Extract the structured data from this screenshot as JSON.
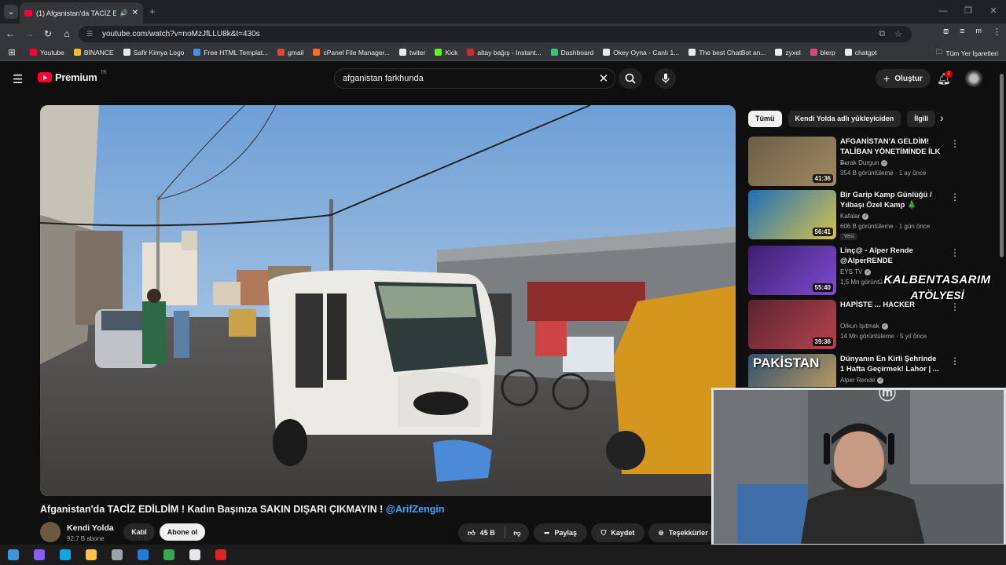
{
  "browser": {
    "tab_title": "(1) Afganistan'da TACİZ EDİ...",
    "url": "youtube.com/watch?v=noMzJfLLU8k&t=430s",
    "bookmarks": [
      {
        "label": "Youtube",
        "color": "#ff0033"
      },
      {
        "label": "BİNANCE",
        "color": "#f3ba2f"
      },
      {
        "label": "Safir Kimya Logo",
        "color": "#e8eaed"
      },
      {
        "label": "Free HTML Templat...",
        "color": "#4a90d9"
      },
      {
        "label": "gmail",
        "color": "#ea4335"
      },
      {
        "label": "cPanel File Manager...",
        "color": "#ff6c2c"
      },
      {
        "label": "twiter",
        "color": "#e8eaed"
      },
      {
        "label": "Kick",
        "color": "#53fc18"
      },
      {
        "label": "altay bağış - Instant...",
        "color": "#c4302b"
      },
      {
        "label": "Dashboard",
        "color": "#2ecc71"
      },
      {
        "label": "Okey Oyna - Canlı 1...",
        "color": "#e8eaed"
      },
      {
        "label": "The best ChatBot an...",
        "color": "#e8eaed"
      },
      {
        "label": "zyxel",
        "color": "#e8eaed"
      },
      {
        "label": "blerp",
        "color": "#e0457b"
      },
      {
        "label": "chatgpt",
        "color": "#e8eaed"
      }
    ],
    "all_bookmarks_label": "Tüm Yer İşaretleri",
    "profile_initial": "m"
  },
  "yt": {
    "logo_text": "Premium",
    "logo_region": "TR",
    "search_query": "afganistan farkhunda",
    "create_label": "Oluştur",
    "notif_count": "1"
  },
  "video": {
    "title": "Afganistan'da TACİZ EDİLDİM ! Kadın Başınıza SAKIN DIŞARI ÇIKMAYIN !",
    "mention": "@ArifZengin",
    "channel": "Kendi Yolda",
    "subscribers": "92,7 B abone",
    "join_label": "Katıl",
    "subscribe_label": "Abone ol",
    "likes": "45 B",
    "share_label": "Paylaş",
    "save_label": "Kaydet",
    "thanks_label": "Teşekkürler"
  },
  "chips": [
    "Tümü",
    "Kendi Yolda adlı yükleyiciden",
    "İlgili"
  ],
  "recommendations": [
    {
      "title": "AFGANİSTAN'A GELDİM! TALİBAN YÖNETİMİNDE İLK ...",
      "channel": "Burak Durgun",
      "verified": true,
      "meta": "354 B görüntüleme · 1 ay önce",
      "duration": "41:36",
      "colors": [
        "#6b5d45",
        "#a08a62"
      ]
    },
    {
      "title": "Bir Garip Kamp Günlüğü / Yılbaşı Özel Kamp 🎄",
      "channel": "Kafalar",
      "verified": true,
      "meta": "606 B görüntüleme · 1 gün önce",
      "duration": "56:41",
      "badge": "Yeni",
      "colors": [
        "#1d6fb8",
        "#d8c24a"
      ]
    },
    {
      "title": "Linç@ - Alper Rende @AlperRENDE",
      "channel": "EYS TV",
      "verified": true,
      "meta": "1,5 Mn görüntüleme",
      "duration": "55:40",
      "colors": [
        "#3b1f6e",
        "#7f4bd0"
      ]
    },
    {
      "title": "HAPİSTE ... HACKER",
      "channel": "Orkun Işıtmak",
      "verified": true,
      "meta": "14 Mn görüntüleme · 5 yıl önce",
      "duration": "39:36",
      "colors": [
        "#5a2330",
        "#b8434f"
      ]
    },
    {
      "title": "Dünyanın En Kirli Şehrinde 1 Hafta Geçirmek! Lahor | ...",
      "channel": "Alper Rende",
      "verified": true,
      "meta": "",
      "duration": "",
      "thumb_text": "PAKİSTAN",
      "colors": [
        "#2f4f6f",
        "#c9a35e"
      ]
    }
  ],
  "overlay": {
    "line1": "KALBENTASARIM",
    "line2": "ATÖLYESİ"
  },
  "taskbar": [
    {
      "name": "windows-start-icon",
      "color": "#3a96dd"
    },
    {
      "name": "copilot-icon",
      "color": "#8b5cf6"
    },
    {
      "name": "edge-icon",
      "color": "#0ea5e9"
    },
    {
      "name": "file-explorer-icon",
      "color": "#f6c344"
    },
    {
      "name": "calculator-icon",
      "color": "#9ca3af"
    },
    {
      "name": "outlook-icon",
      "color": "#1d7fd6"
    },
    {
      "name": "chrome-icon",
      "color": "#34a853"
    },
    {
      "name": "obs-icon",
      "color": "#e5e7eb"
    },
    {
      "name": "app-red-icon",
      "color": "#dc2626"
    }
  ]
}
